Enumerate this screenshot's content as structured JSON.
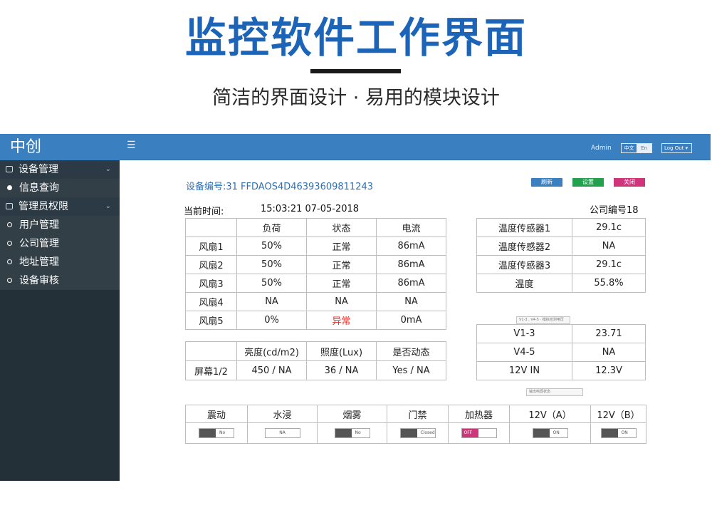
{
  "promo": {
    "title": "监控软件工作界面",
    "subtitle": "简洁的界面设计 · 易用的模块设计"
  },
  "app": {
    "brand": "中创",
    "topbar": {
      "admin": "Admin",
      "lang_zh": "中文",
      "lang_en": "En",
      "logout": "Log Out ▾"
    },
    "sidebar": {
      "items": [
        {
          "label": "设备管理"
        },
        {
          "label": "信息查询"
        },
        {
          "label": "管理员权限"
        },
        {
          "label": "用户管理"
        },
        {
          "label": "公司管理"
        },
        {
          "label": "地址管理"
        },
        {
          "label": "设备审核"
        }
      ]
    },
    "main": {
      "device_id": "设备编号:31 FFDAOS4D46393609811243",
      "time_label": "当前时间:",
      "time_value": "15:03:21  07-05-2018",
      "company_no": "公司编号18",
      "buttons": {
        "refresh": "刷新",
        "settings": "设置",
        "close": "关闭"
      },
      "fans": {
        "headers": [
          "负荷",
          "状态",
          "电流"
        ],
        "rows": [
          {
            "name": "风扇1",
            "load": "50%",
            "status": "正常",
            "current": "86mA"
          },
          {
            "name": "风扇2",
            "load": "50%",
            "status": "正常",
            "current": "86mA"
          },
          {
            "name": "风扇3",
            "load": "50%",
            "status": "正常",
            "current": "86mA"
          },
          {
            "name": "风扇4",
            "load": "NA",
            "status": "NA",
            "current": "NA"
          },
          {
            "name": "风扇5",
            "load": "0%",
            "status": "异常",
            "current": "0mA"
          }
        ]
      },
      "screen": {
        "headers": [
          "亮度(cd/m2)",
          "照度(Lux)",
          "是否动态"
        ],
        "row": {
          "name": "屏幕1/2",
          "brightness": "450 / NA",
          "illuminance": "36 / NA",
          "dynamic": "Yes / NA"
        }
      },
      "temperature": [
        {
          "label": "温度传感器1",
          "value": "29.1c"
        },
        {
          "label": "温度传感器2",
          "value": "NA"
        },
        {
          "label": "温度传感器3",
          "value": "29.1c"
        },
        {
          "label": "温度",
          "value": "55.8%"
        }
      ],
      "voltage_tag": "V1-3 , V4-5 · 模拟检测电压",
      "voltage": [
        {
          "label": "V1-3",
          "value": "23.71"
        },
        {
          "label": "V4-5",
          "value": "NA"
        },
        {
          "label": "12V IN",
          "value": "12.3V"
        }
      ],
      "status_tag": "输出电源状态",
      "status_items": [
        {
          "label": "震动",
          "switch": "No"
        },
        {
          "label": "水浸",
          "switch": "NA"
        },
        {
          "label": "烟雾",
          "switch": "No"
        },
        {
          "label": "门禁",
          "switch": "Closed"
        },
        {
          "label": "加热器",
          "switch": "OFF"
        },
        {
          "label": "12V（A）",
          "switch": "ON"
        },
        {
          "label": "12V（B）",
          "switch": "ON"
        }
      ]
    }
  }
}
